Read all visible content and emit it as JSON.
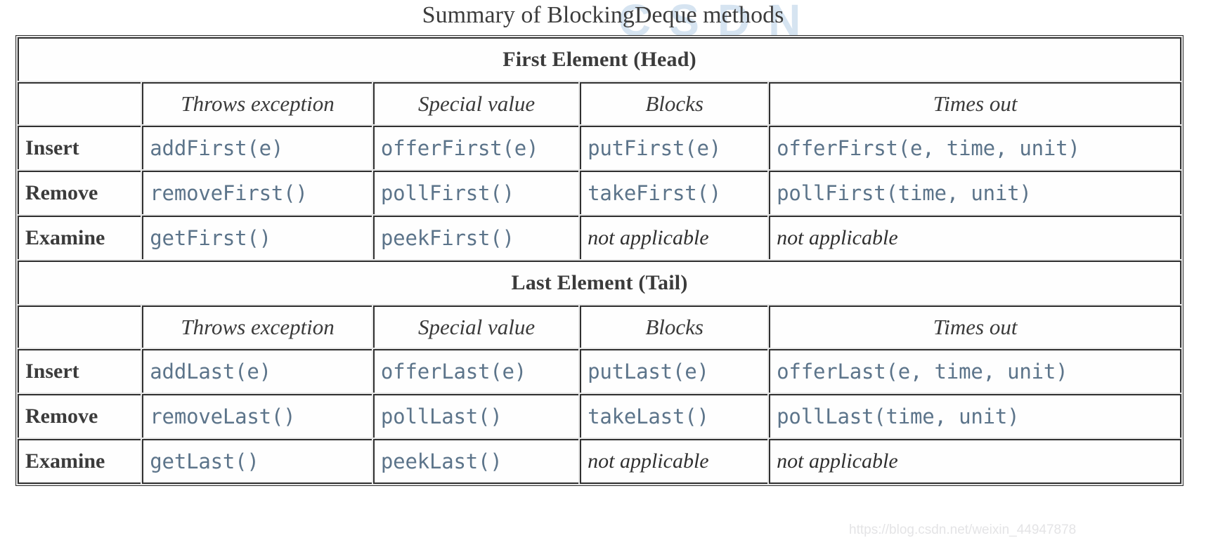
{
  "title": "Summary of BlockingDeque methods",
  "watermark": {
    "background_text": "CSDN",
    "url": "https://blog.csdn.net/weixin_44947878"
  },
  "colors": {
    "code_text": "#5c748a",
    "label_text": "#3b3b3b",
    "border": "#303030",
    "watermark_blue": "#cfe0ef"
  },
  "table": {
    "column_headers": [
      "",
      "Throws exception",
      "Special value",
      "Blocks",
      "Times out"
    ],
    "sections": [
      {
        "heading": "First Element (Head)",
        "rows": [
          {
            "label": "Insert",
            "cells": [
              {
                "text": "addFirst(e)",
                "style": "code"
              },
              {
                "text": "offerFirst(e)",
                "style": "code"
              },
              {
                "text": "putFirst(e)",
                "style": "code"
              },
              {
                "text": "offerFirst(e, time, unit)",
                "style": "code"
              }
            ]
          },
          {
            "label": "Remove",
            "cells": [
              {
                "text": "removeFirst()",
                "style": "code"
              },
              {
                "text": "pollFirst()",
                "style": "code"
              },
              {
                "text": "takeFirst()",
                "style": "code"
              },
              {
                "text": "pollFirst(time, unit)",
                "style": "code"
              }
            ]
          },
          {
            "label": "Examine",
            "cells": [
              {
                "text": "getFirst()",
                "style": "code"
              },
              {
                "text": "peekFirst()",
                "style": "code"
              },
              {
                "text": "not applicable",
                "style": "na"
              },
              {
                "text": "not applicable",
                "style": "na"
              }
            ]
          }
        ]
      },
      {
        "heading": "Last Element (Tail)",
        "rows": [
          {
            "label": "Insert",
            "cells": [
              {
                "text": "addLast(e)",
                "style": "code"
              },
              {
                "text": "offerLast(e)",
                "style": "code"
              },
              {
                "text": "putLast(e)",
                "style": "code"
              },
              {
                "text": "offerLast(e, time, unit)",
                "style": "code"
              }
            ]
          },
          {
            "label": "Remove",
            "cells": [
              {
                "text": "removeLast()",
                "style": "code"
              },
              {
                "text": "pollLast()",
                "style": "code"
              },
              {
                "text": "takeLast()",
                "style": "code"
              },
              {
                "text": "pollLast(time, unit)",
                "style": "code"
              }
            ]
          },
          {
            "label": "Examine",
            "cells": [
              {
                "text": "getLast()",
                "style": "code"
              },
              {
                "text": "peekLast()",
                "style": "code"
              },
              {
                "text": "not applicable",
                "style": "na"
              },
              {
                "text": "not applicable",
                "style": "na"
              }
            ]
          }
        ]
      }
    ]
  }
}
